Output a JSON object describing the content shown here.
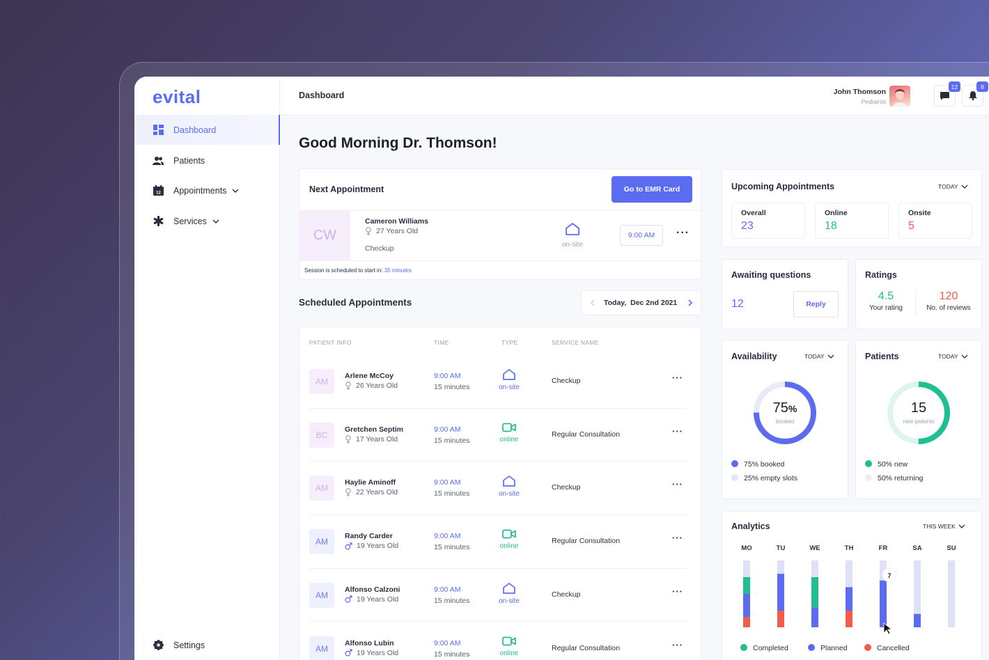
{
  "app": {
    "logo": "evital"
  },
  "sidebar": {
    "items": [
      {
        "label": "Dashboard"
      },
      {
        "label": "Patients"
      },
      {
        "label": "Appointments"
      },
      {
        "label": "Services"
      }
    ],
    "settings_label": "Settings"
  },
  "header": {
    "breadcrumb": "Dashboard",
    "user_name": "John Thomson",
    "user_role": "Pediatrist",
    "messages_count": "12",
    "notifications_count": "8"
  },
  "greeting": "Good Morning Dr. Thomson!",
  "next_appointment": {
    "title": "Next Appointment",
    "button_label": "Go to EMR Card",
    "initials": "CW",
    "patient_name": "Cameron Williams",
    "patient_age": "27 Years Old",
    "service": "Checkup",
    "type_label": "on-site",
    "time": "9:00 AM",
    "session_text": "Session is scheduled to start in:",
    "session_eta": "35 minutes"
  },
  "scheduled": {
    "title": "Scheduled Appointments",
    "date_label": "Today,  Dec 2nd 2021",
    "columns": [
      "PATIENT INFO",
      "TIME",
      "TYPE",
      "SERVICE NAME"
    ],
    "rows": [
      {
        "initials": "AM",
        "name": "Arlene McCoy",
        "age": "26 Years Old",
        "gender": "female",
        "time": "9:00 AM",
        "duration": "15 minutes",
        "type": "on-site",
        "service": "Checkup"
      },
      {
        "initials": "BC",
        "name": "Gretchen Septim",
        "age": "17 Years Old",
        "gender": "female",
        "time": "9:00 AM",
        "duration": "15 minutes",
        "type": "online",
        "service": "Regular Consultation"
      },
      {
        "initials": "AM",
        "name": "Haylie Aminoff",
        "age": "22 Years Old",
        "gender": "female",
        "time": "9:00 AM",
        "duration": "15 minutes",
        "type": "on-site",
        "service": "Checkup"
      },
      {
        "initials": "AM",
        "name": "Randy Carder",
        "age": "19 Years Old",
        "gender": "male",
        "time": "9:00 AM",
        "duration": "15 minutes",
        "type": "online",
        "service": "Regular Consultation"
      },
      {
        "initials": "AM",
        "name": "Alfonso Calzoni",
        "age": "19 Years Old",
        "gender": "male",
        "time": "9:00 AM",
        "duration": "15 minutes",
        "type": "on-site",
        "service": "Checkup"
      },
      {
        "initials": "AM",
        "name": "Alfonso Lubin",
        "age": "19 Years Old",
        "gender": "male",
        "time": "9:00 AM",
        "duration": "15 minutes",
        "type": "online",
        "service": "Regular Consultation"
      }
    ]
  },
  "upcoming": {
    "title": "Upcoming Appointments",
    "filter": "TODAY",
    "overall_label": "Overall",
    "overall": "23",
    "online_label": "Online",
    "online": "18",
    "onsite_label": "Onsite",
    "onsite": "5"
  },
  "awaiting": {
    "title": "Awaiting questions",
    "count": "12",
    "reply_label": "Reply"
  },
  "ratings": {
    "title": "Ratings",
    "rating": "4.5",
    "rating_label": "Your rating",
    "reviews": "120",
    "reviews_label": "No. of reviews"
  },
  "availability": {
    "title": "Availability",
    "filter": "TODAY",
    "percent": "75",
    "percent_sign": "%",
    "center_label": "booked",
    "booked_fraction": 0.75,
    "legend_booked": "75% booked",
    "legend_empty": "25% empty slots"
  },
  "patients_widget": {
    "title": "Patients",
    "filter": "TODAY",
    "count": "15",
    "center_label": "new patients",
    "new_fraction": 0.5,
    "legend_new": "50% new",
    "legend_returning": "50% returning"
  },
  "colors": {
    "accent": "#5b6cf0",
    "green": "#1fbf92",
    "red": "#f25c4b",
    "track": "#dfe2f7"
  },
  "chart_data": {
    "type": "bar",
    "title": "Analytics",
    "filter": "THIS WEEK",
    "categories": [
      "MO",
      "TU",
      "WE",
      "TH",
      "FR",
      "SA",
      "SU"
    ],
    "max": 10,
    "series": [
      {
        "name": "Completed",
        "values": [
          2.5,
          0,
          4.5,
          0,
          0,
          0,
          0
        ]
      },
      {
        "name": "Planned",
        "values": [
          3.5,
          5.5,
          3,
          3.5,
          7,
          2,
          0
        ]
      },
      {
        "name": "Cancelled",
        "values": [
          1.5,
          2.5,
          0,
          2.5,
          0,
          0,
          0
        ]
      }
    ],
    "tooltip": {
      "day": "FR",
      "value": "7"
    }
  }
}
